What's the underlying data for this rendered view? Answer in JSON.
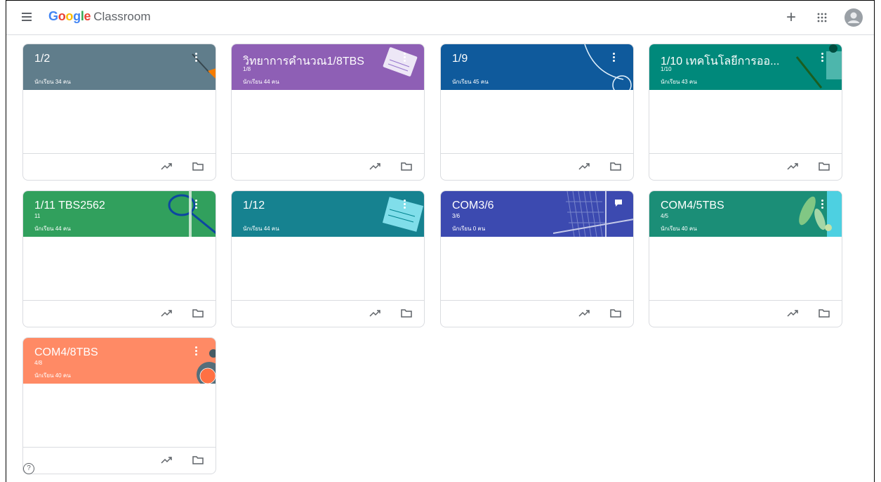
{
  "header": {
    "logo_google": "Google",
    "logo_product": "Classroom",
    "create_label": "+"
  },
  "colors": {
    "c1": "#607d8b",
    "c2": "#8e5fb5",
    "c3": "#0f5a9c",
    "c4": "#00897b",
    "c5": "#31a05d",
    "c6": "#168290",
    "c7": "#3c4ab0",
    "c8": "#1b8e77",
    "c9": "#ff8a65"
  },
  "cards": [
    {
      "title": "1/2",
      "section": "",
      "students": "นักเรียน 34 คน"
    },
    {
      "title": "วิทยาการคำนวณ1/8TBS",
      "section": "1/8",
      "students": "นักเรียน 44 คน"
    },
    {
      "title": "1/9",
      "section": "",
      "students": "นักเรียน 45 คน"
    },
    {
      "title": "1/10 เทคโนโลยีการออ...",
      "section": "1/10",
      "students": "นักเรียน 43 คน"
    },
    {
      "title": "1/11 TBS2562",
      "section": "11",
      "students": "นักเรียน 44 คน"
    },
    {
      "title": "1/12",
      "section": "",
      "students": "นักเรียน 44 คน"
    },
    {
      "title": "COM3/6",
      "section": "3/6",
      "students": "นักเรียน 0 คน"
    },
    {
      "title": "COM4/5TBS",
      "section": "4/5",
      "students": "นักเรียน 40 คน"
    },
    {
      "title": "COM4/8TBS",
      "section": "4/8",
      "students": "นักเรียน 40 คน"
    }
  ],
  "help_label": "?"
}
